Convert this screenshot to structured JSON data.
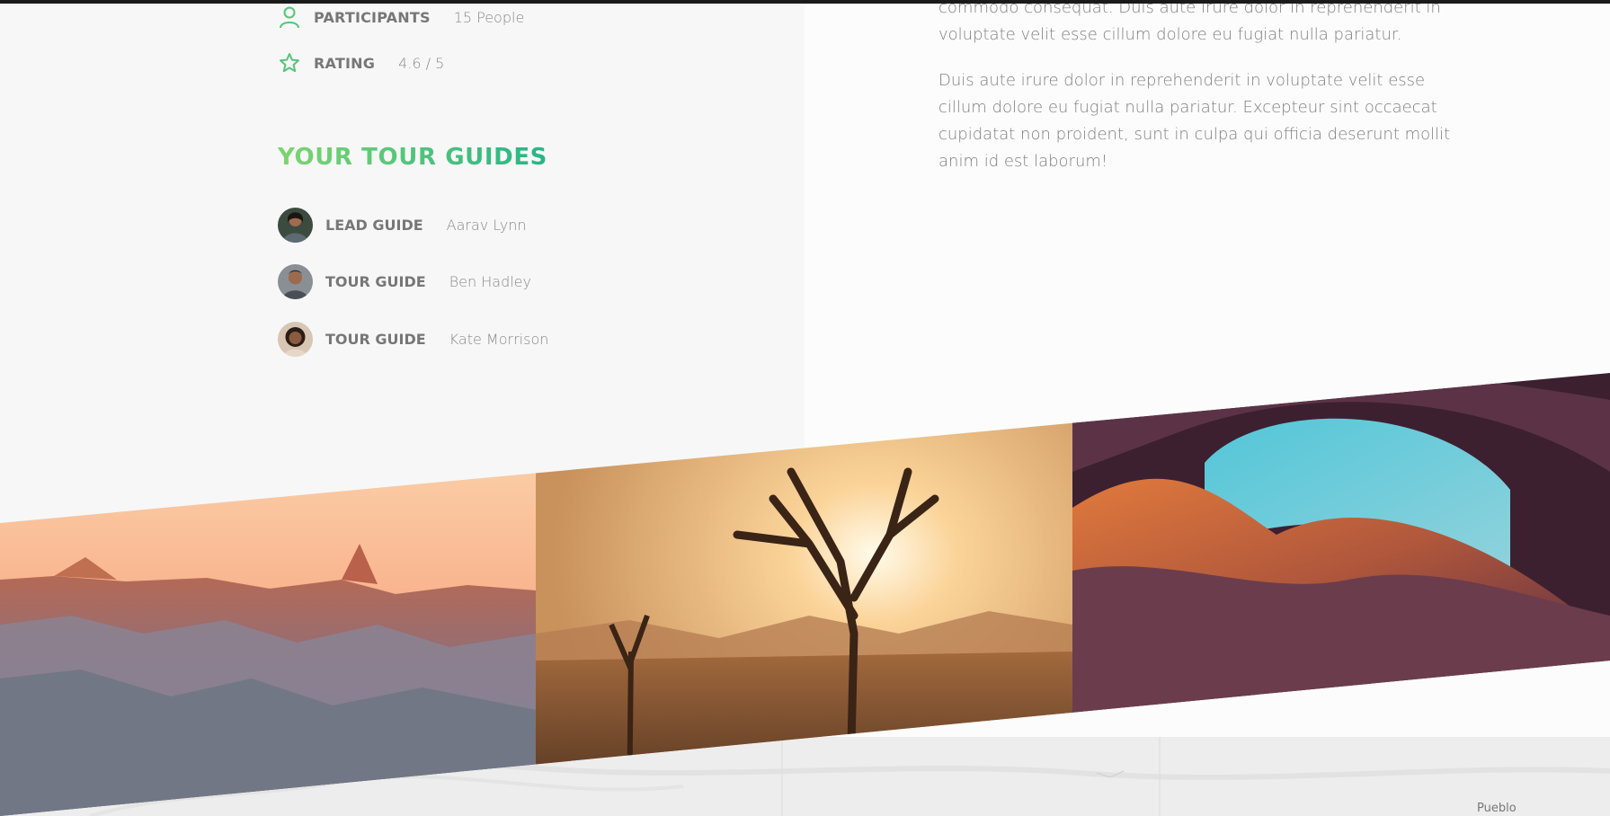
{
  "facts": [
    {
      "label": "PARTICIPANTS",
      "value": "15 People",
      "icon": "user-icon"
    },
    {
      "label": "RATING",
      "value": "4.6 / 5",
      "icon": "star-icon"
    }
  ],
  "guides_section": {
    "heading": "YOUR TOUR GUIDES",
    "guides": [
      {
        "role": "LEAD GUIDE",
        "name": "Aarav Lynn"
      },
      {
        "role": "TOUR GUIDE",
        "name": "Ben Hadley"
      },
      {
        "role": "TOUR GUIDE",
        "name": "Kate Morrison"
      }
    ]
  },
  "description": {
    "paragraph_1_tail": "commodo consequat. Duis aute irure dolor in reprehenderit in voluptate velit esse cillum dolore eu fugiat nulla pariatur.",
    "paragraph_2": "Duis aute irure dolor in reprehenderit in voluptate velit esse cillum dolore eu fugiat nulla pariatur. Excepteur sint occaecat cupidatat non proident, sunt in culpa qui officia deserunt mollit anim id est laborum!"
  },
  "map": {
    "place_label": "Pueblo"
  },
  "colors": {
    "accent_start": "#7dd56f",
    "accent_end": "#28b487"
  }
}
